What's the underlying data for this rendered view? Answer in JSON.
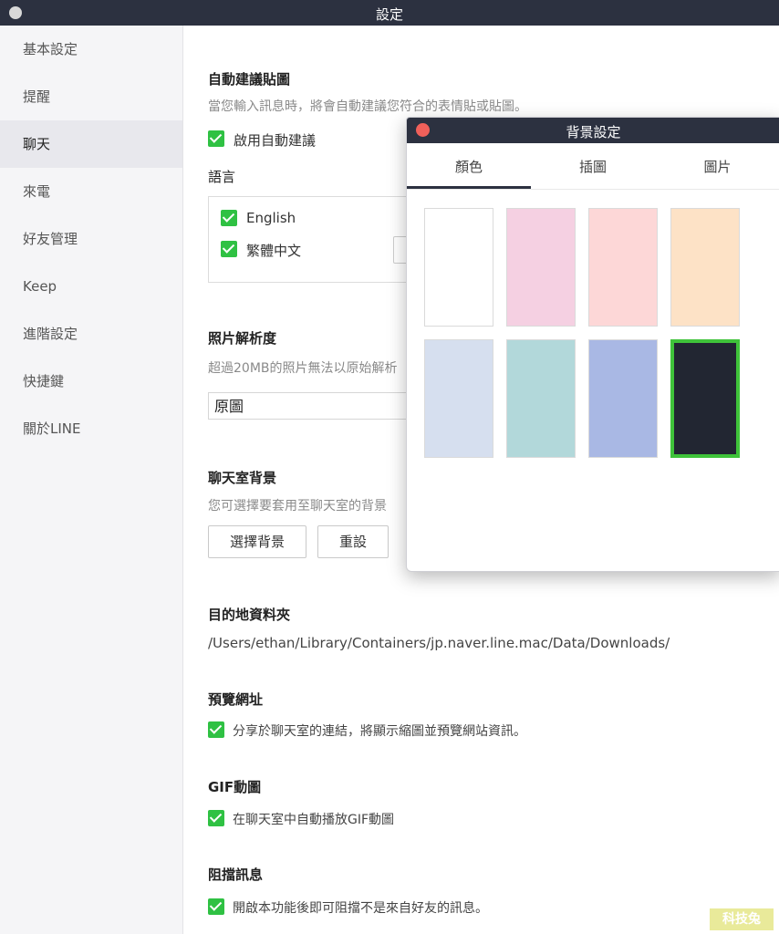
{
  "window": {
    "title": "設定"
  },
  "sidebar": {
    "items": [
      {
        "label": "基本設定"
      },
      {
        "label": "提醒"
      },
      {
        "label": "聊天"
      },
      {
        "label": "來電"
      },
      {
        "label": "好友管理"
      },
      {
        "label": "Keep"
      },
      {
        "label": "進階設定"
      },
      {
        "label": "快捷鍵"
      },
      {
        "label": "關於LINE"
      }
    ],
    "active": "聊天"
  },
  "settings": {
    "sticker_suggest": {
      "title": "自動建議貼圖",
      "description": "當您輸入訊息時，將會自動建議您符合的表情貼或貼圖。",
      "checkbox_label": "啟用自動建議",
      "checked": true
    },
    "language": {
      "title": "語言",
      "options": [
        {
          "label": "English",
          "checked": true
        },
        {
          "label": "繁體中文",
          "checked": true
        }
      ]
    },
    "photo_resolution": {
      "title": "照片解析度",
      "description": "超過20MB的照片無法以原始解析",
      "selected": "原圖"
    },
    "chat_background": {
      "title": "聊天室背景",
      "description": "您可選擇要套用至聊天室的背景",
      "choose_button": "選擇背景",
      "reset_button": "重設"
    },
    "download_folder": {
      "title": "目的地資料夾",
      "path": "/Users/ethan/Library/Containers/jp.naver.line.mac/Data/Downloads/"
    },
    "url_preview": {
      "title": "預覽網址",
      "checkbox_label": "分享於聊天室的連結，將顯示縮圖並預覽網站資訊。",
      "checked": true
    },
    "gif": {
      "title": "GIF動圖",
      "checkbox_label": "在聊天室中自動播放GIF動圖",
      "checked": true
    },
    "block_messages": {
      "title": "阻擋訊息",
      "checkbox_label": "開啟本功能後即可阻擋不是來自好友的訊息。",
      "checked": true
    }
  },
  "popup": {
    "title": "背景設定",
    "tabs": [
      {
        "label": "顏色",
        "active": true
      },
      {
        "label": "插圖"
      },
      {
        "label": "圖片"
      }
    ],
    "swatches": [
      {
        "color": "#ffffff"
      },
      {
        "color": "#f5d0e2"
      },
      {
        "color": "#fdd7d7"
      },
      {
        "color": "#fde2c6"
      },
      {
        "color": "#d6dfef"
      },
      {
        "color": "#b2d8da"
      },
      {
        "color": "#a9b8e4"
      },
      {
        "color": "#222632",
        "selected": true
      }
    ]
  },
  "watermark": {
    "text": "科技兔"
  },
  "colors": {
    "titlebar": "#2c3140",
    "checkbox": "#2fc143",
    "selection": "#3fc33a",
    "close": "#f0605a"
  }
}
